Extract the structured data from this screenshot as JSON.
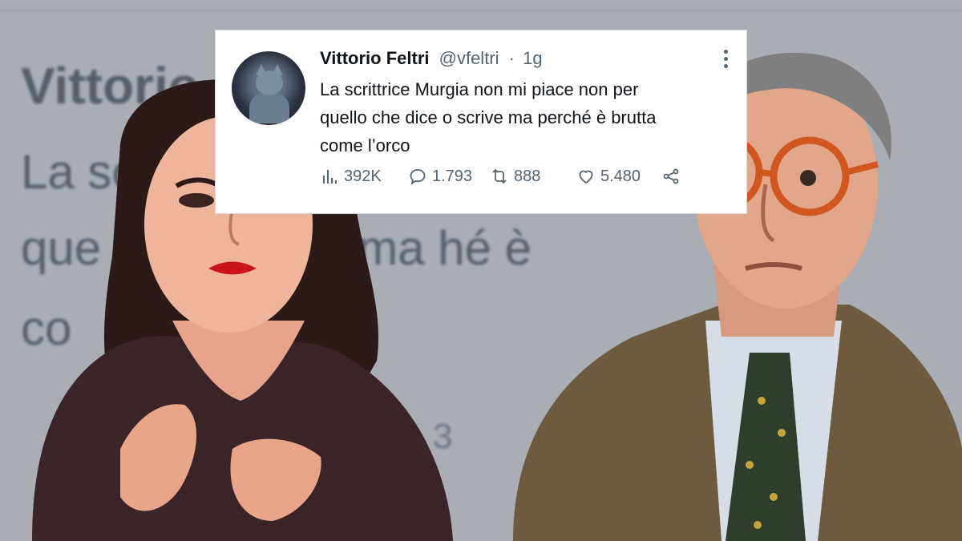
{
  "background_tweet": {
    "name_fragment": "Vittorio",
    "line1": "La sc                                              no",
    "line2": "que          ce o scrive ma      hé è",
    "line3": "co",
    "count_fragment": "3"
  },
  "tweet": {
    "display_name": "Vittorio Feltri",
    "handle": "@vfeltri",
    "separator": "·",
    "time": "1g",
    "text_lines": [
      "La scrittrice Murgia non mi piace non per",
      "quello che dice o scrive ma perché è brutta",
      "come l’orco"
    ],
    "views": "392K",
    "replies": "1.793",
    "retweets": "888",
    "likes": "5.480"
  },
  "icons": {
    "avatar": "cat-avatar",
    "more": "more-options-icon",
    "views": "analytics-icon",
    "replies": "reply-icon",
    "retweets": "retweet-icon",
    "likes": "heart-icon",
    "share": "share-icon"
  },
  "colors": {
    "card_bg": "#ffffff",
    "text_primary": "#0f1419",
    "text_secondary": "#536471",
    "background": "#a9adb5"
  }
}
